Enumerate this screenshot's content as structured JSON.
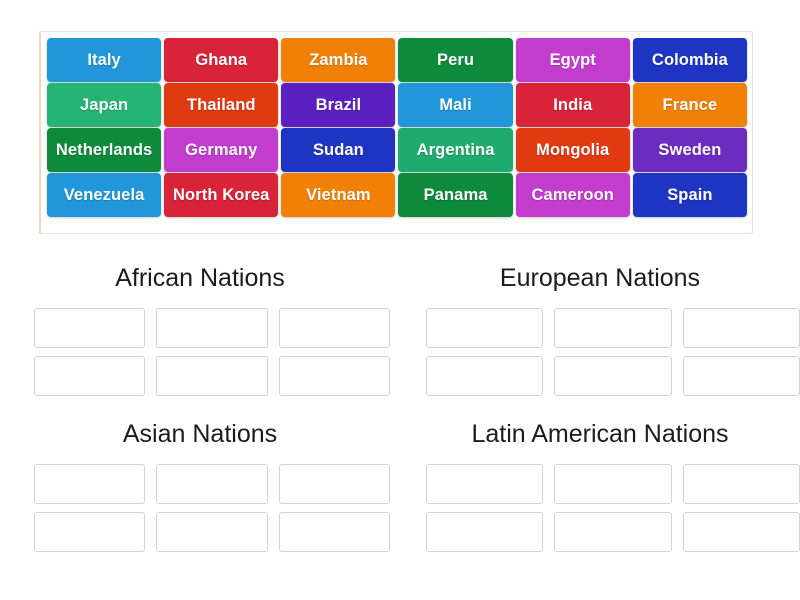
{
  "word_bank": {
    "name": "country-word-bank",
    "tiles": [
      {
        "label": "Italy",
        "color": "#2196d9"
      },
      {
        "label": "Ghana",
        "color": "#d92338"
      },
      {
        "label": "Zambia",
        "color": "#f08008"
      },
      {
        "label": "Peru",
        "color": "#0e8a3c"
      },
      {
        "label": "Egypt",
        "color": "#c23cce"
      },
      {
        "label": "Colombia",
        "color": "#1e35c4"
      },
      {
        "label": "Japan",
        "color": "#25b473"
      },
      {
        "label": "Thailand",
        "color": "#e03a10"
      },
      {
        "label": "Brazil",
        "color": "#5b21c0"
      },
      {
        "label": "Mali",
        "color": "#2196d9"
      },
      {
        "label": "India",
        "color": "#d92338"
      },
      {
        "label": "France",
        "color": "#f08008"
      },
      {
        "label": "Netherlands",
        "color": "#0e8a3c"
      },
      {
        "label": "Germany",
        "color": "#c23cce"
      },
      {
        "label": "Sudan",
        "color": "#1e35c4"
      },
      {
        "label": "Argentina",
        "color": "#1fab6e"
      },
      {
        "label": "Mongolia",
        "color": "#e03a10"
      },
      {
        "label": "Sweden",
        "color": "#6d2cc0"
      },
      {
        "label": "Venezuela",
        "color": "#2196d9"
      },
      {
        "label": "North Korea",
        "color": "#d92338"
      },
      {
        "label": "Vietnam",
        "color": "#f08008"
      },
      {
        "label": "Panama",
        "color": "#0e8a3c"
      },
      {
        "label": "Cameroon",
        "color": "#c23cce"
      },
      {
        "label": "Spain",
        "color": "#1e35c4"
      }
    ]
  },
  "categories": [
    {
      "title": "African Nations",
      "slots": [
        "",
        "",
        "",
        "",
        "",
        ""
      ]
    },
    {
      "title": "European Nations",
      "slots": [
        "",
        "",
        "",
        "",
        "",
        ""
      ]
    },
    {
      "title": "Asian Nations",
      "slots": [
        "",
        "",
        "",
        "",
        "",
        ""
      ]
    },
    {
      "title": "Latin American Nations",
      "slots": [
        "",
        "",
        "",
        "",
        "",
        ""
      ]
    }
  ]
}
